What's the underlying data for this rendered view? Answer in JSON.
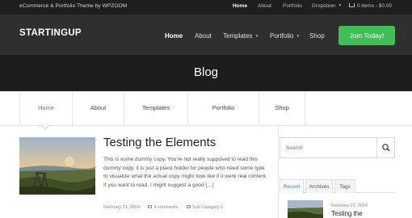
{
  "topbar": {
    "tagline": "eCommerce & Portfolio Theme by WPZOOM",
    "nav": [
      "Home",
      "About",
      "Portfolio",
      "Dropdown"
    ],
    "cart": "0 items - $0.00"
  },
  "header": {
    "logo": "STARTINGUP",
    "nav": [
      "Home",
      "About",
      "Templates",
      "Portfolio",
      "Shop"
    ],
    "cta": "Join Today!"
  },
  "hero": {
    "title": "Blog"
  },
  "subnav": {
    "tabs": [
      "Home",
      "About",
      "Templates",
      "Portfolio",
      "Shop"
    ]
  },
  "post": {
    "title": "Testing the Elements",
    "excerpt": "This is some dummy copy. You're not really supposed to read this dummy copy, it is just a place holder for people who need some type to visualize what the actual copy might look like if it were real content. If you want to read, I might suggest a good […]",
    "date": "February 21, 2014",
    "comments": "4 comments",
    "category": "Sub Category 1"
  },
  "sidebar": {
    "search_placeholder": "Search",
    "tabs": [
      "Recent",
      "Archives",
      "Tags"
    ],
    "recent": {
      "date": "February 21, 2014",
      "title": "Testing the"
    }
  },
  "colors": {
    "accent": "#3fbf55",
    "link": "#3a7bd5",
    "dark": "#2f2f2f"
  }
}
